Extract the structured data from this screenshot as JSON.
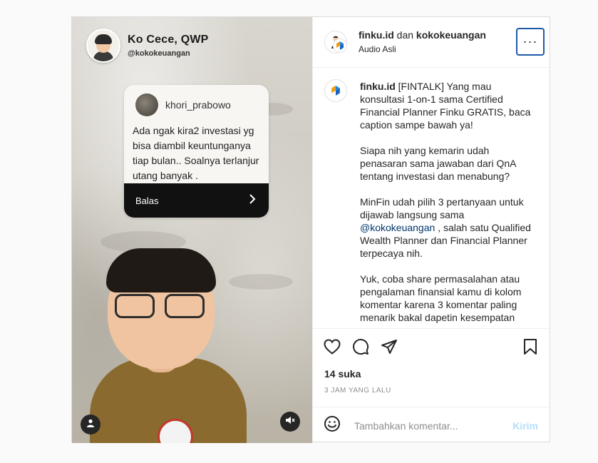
{
  "media": {
    "host_name": "Ko Cece, QWP",
    "host_handle": "@kokokeuangan",
    "question": {
      "username": "khori_prabowo",
      "text": "Ada ngak kira2 investasi yg bisa diambil keuntunganya tiap bulan.. Soalnya terlanjur utang banyak .",
      "reply_label": "Balas",
      "reply_icon": "chevron-right-icon"
    },
    "user_tag_icon": "person-icon",
    "mute_icon": "speaker-muted-icon"
  },
  "header": {
    "account_primary": "finku.id",
    "joiner": "dan",
    "account_secondary": "kokokeuangan",
    "audio": "Audio Asli",
    "more_label": "···"
  },
  "caption": {
    "author": "finku.id",
    "p1": "[FINTALK] Yang mau konsultasi 1-on-1 sama Certified Financial Planner Finku GRATIS, baca caption sampe bawah ya!",
    "p2": "Siapa nih yang kemarin udah penasaran sama jawaban dari QnA tentang investasi dan menabung?",
    "p3a": "MinFin udah pilih 3 pertanyaan untuk dijawab langsung sama",
    "mention": "@kokokeuangan",
    "p3b": ", salah satu Qualified Wealth Planner dan Financial Planner terpecaya nih.",
    "p4": "Yuk, coba share permasalahan atau pengalaman finansial kamu di kolom komentar karena 3 komentar paling menarik bakal dapetin kesempatan"
  },
  "actions": {
    "icons": [
      "heart-icon",
      "comment-icon",
      "share-icon",
      "bookmark-icon"
    ],
    "likes": "14 suka",
    "time": "3 JAM YANG LALU"
  },
  "comment": {
    "placeholder": "Tambahkan komentar...",
    "post_label": "Kirim",
    "emoji_icon": "emoji-icon"
  },
  "colors": {
    "link": "#00376b",
    "post_button_disabled": "#b2dffc",
    "focus_ring": "#1e5aa8"
  }
}
